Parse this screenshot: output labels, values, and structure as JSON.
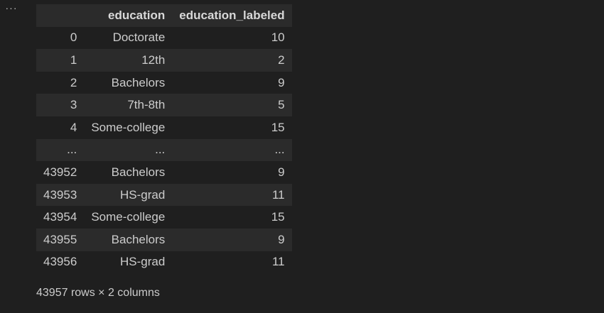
{
  "toolbar": {
    "more_label": "···"
  },
  "table": {
    "columns": [
      "",
      "education",
      "education_labeled"
    ],
    "rows": [
      {
        "index": "0",
        "education": "Doctorate",
        "education_labeled": "10"
      },
      {
        "index": "1",
        "education": "12th",
        "education_labeled": "2"
      },
      {
        "index": "2",
        "education": "Bachelors",
        "education_labeled": "9"
      },
      {
        "index": "3",
        "education": "7th-8th",
        "education_labeled": "5"
      },
      {
        "index": "4",
        "education": "Some-college",
        "education_labeled": "15"
      },
      {
        "index": "...",
        "education": "...",
        "education_labeled": "..."
      },
      {
        "index": "43952",
        "education": "Bachelors",
        "education_labeled": "9"
      },
      {
        "index": "43953",
        "education": "HS-grad",
        "education_labeled": "11"
      },
      {
        "index": "43954",
        "education": "Some-college",
        "education_labeled": "15"
      },
      {
        "index": "43955",
        "education": "Bachelors",
        "education_labeled": "9"
      },
      {
        "index": "43956",
        "education": "HS-grad",
        "education_labeled": "11"
      }
    ]
  },
  "footer": {
    "summary": "43957 rows × 2 columns"
  }
}
